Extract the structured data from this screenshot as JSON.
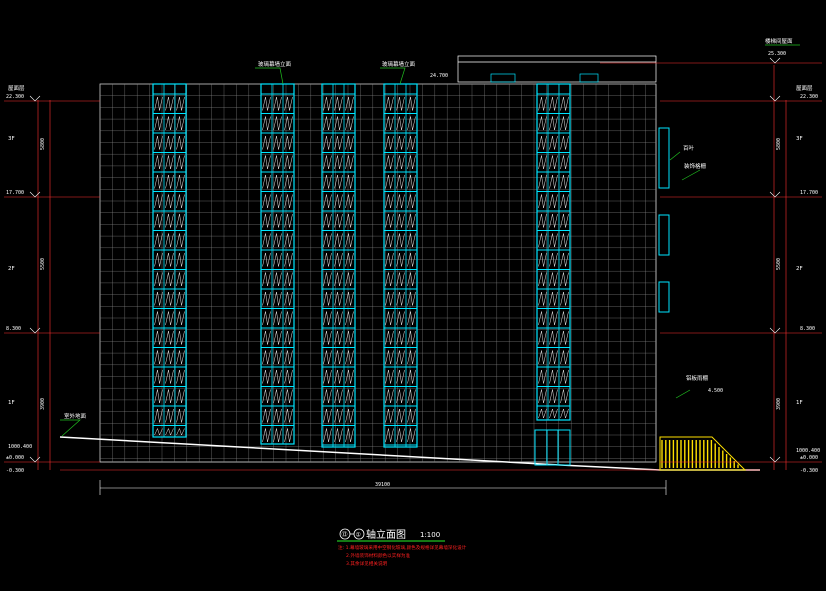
{
  "drawing": {
    "title": "⑬-①轴立面图",
    "title_text": "轴立面图",
    "axis_start": "⑬",
    "axis_end": "①",
    "scale": "1:100"
  },
  "dimensions": {
    "overall_width": "39100",
    "left_segments": [
      "3900",
      "5500",
      "5800"
    ],
    "right_segments": [
      "3900",
      "5500",
      "5800"
    ]
  },
  "levels": {
    "left": [
      {
        "label": "屋面层",
        "elev": "22.300"
      },
      {
        "label": "3F",
        "elev": "17.700"
      },
      {
        "label": "2F",
        "elev": "8.300"
      },
      {
        "label": "1F",
        "elev": "±0.000"
      },
      {
        "label": "",
        "elev": "-0.300"
      }
    ],
    "right": [
      {
        "label": "屋面层",
        "elev": "22.300"
      },
      {
        "label": "3F",
        "elev": "17.700"
      },
      {
        "label": "2F",
        "elev": "8.300"
      },
      {
        "label": "1F",
        "elev": "±0.000"
      },
      {
        "label": "",
        "elev": "-0.300"
      }
    ],
    "roof_top": {
      "label": "楼梯间屋面",
      "elev": "25.300"
    },
    "parapet": "24.700",
    "ground_left": "1000.400",
    "ground_right": "1000.400"
  },
  "annotations": {
    "curtain_wall_1": "玻璃幕墙立面",
    "curtain_wall_2": "玻璃幕墙立面",
    "louver": "百叶",
    "louver2": "装饰格栅",
    "canopy": "铝板雨棚",
    "canopy_elev": "4.500",
    "outdoor_ground": "室外地面"
  },
  "notes": [
    "注: 1.幕墙玻璃采用中空钢化玻璃,颜色及规格详见幕墙深化设计",
    "2.外墙装饰材料颜色以实样为准",
    "3.其余详见相关说明"
  ],
  "colors": {
    "grid": "#ffffff",
    "curtain": "#00e5ff",
    "dimension": "#ff3030",
    "leader": "#20c020",
    "ramp": "#ffe000",
    "note": "#ff2020"
  }
}
